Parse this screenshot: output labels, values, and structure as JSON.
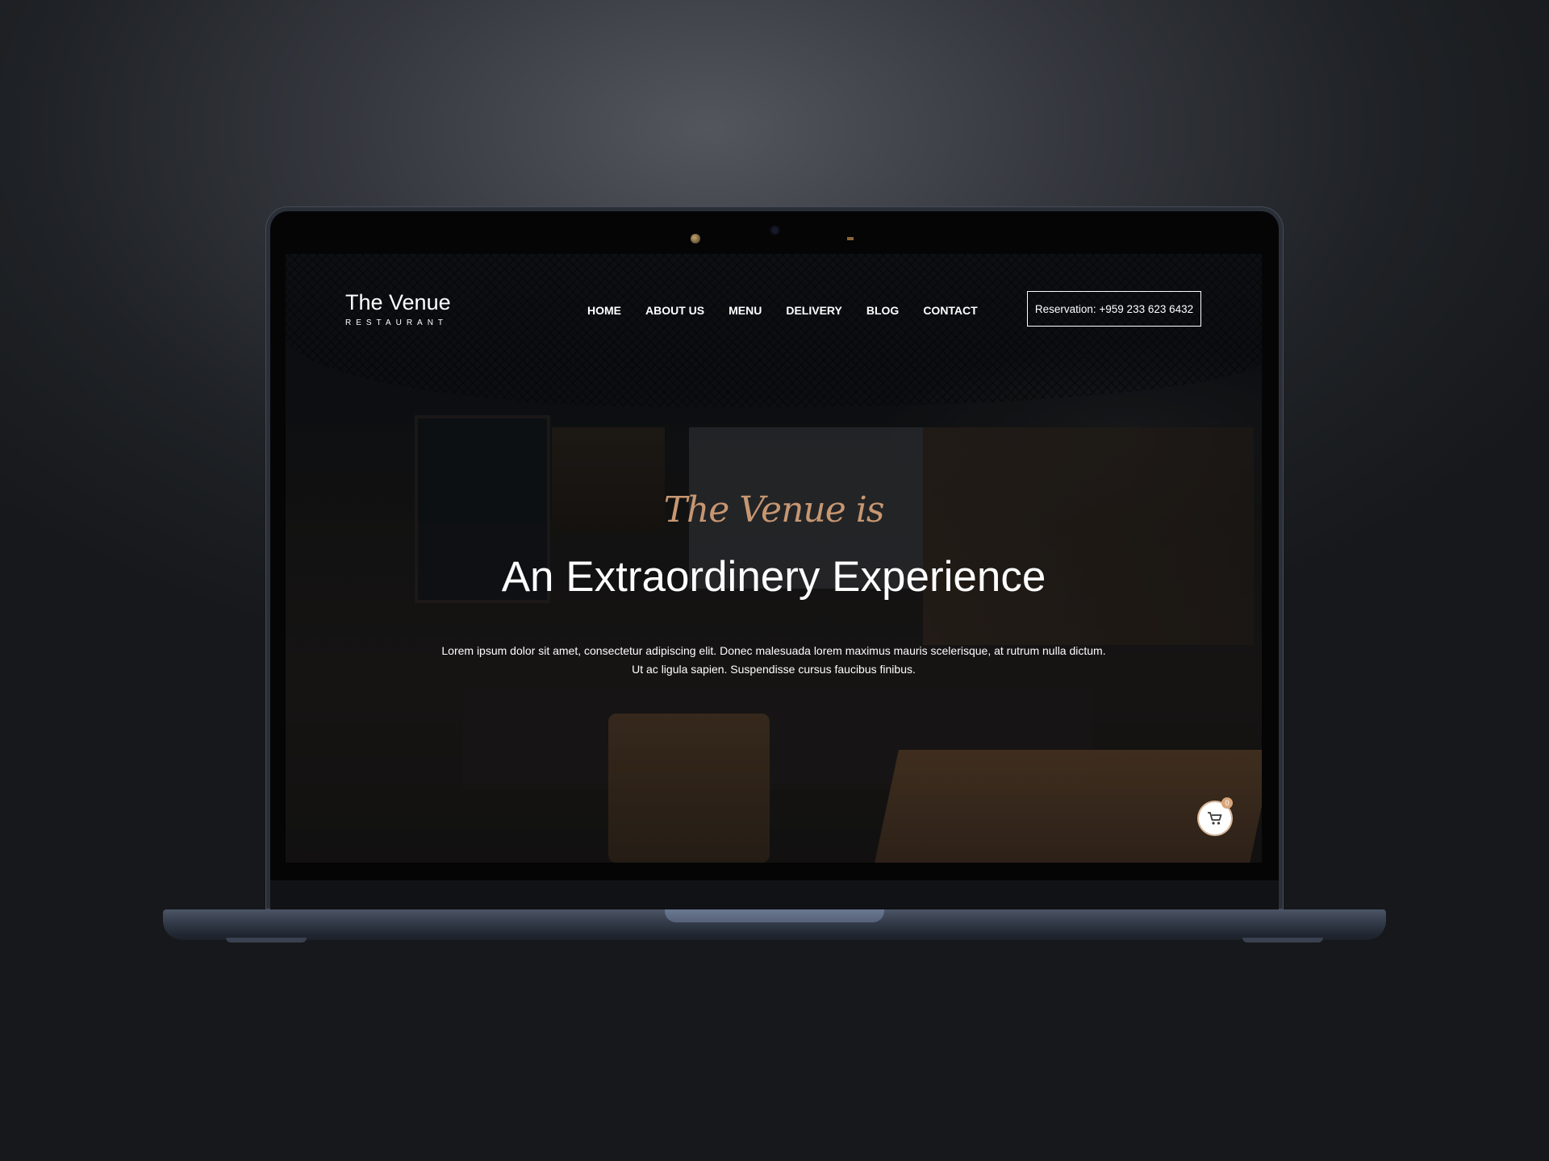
{
  "brand": {
    "title": "The Venue",
    "subtitle": "RESTAURANT"
  },
  "nav": [
    "HOME",
    "ABOUT US",
    "MENU",
    "DELIVERY",
    "BLOG",
    "CONTACT"
  ],
  "reservation": "Reservation: +959 233 623 6432",
  "hero": {
    "script": "The Venue is",
    "headline": "An Extraordinery Experience",
    "line1": "Lorem ipsum dolor sit amet, consectetur adipiscing elit. Donec malesuada lorem maximus mauris scelerisque, at rutrum nulla dictum.",
    "line2": "Ut ac ligula sapien. Suspendisse cursus faucibus finibus."
  },
  "cart": {
    "icon": "cart-icon",
    "count": "0"
  },
  "colors": {
    "accent": "#c79772",
    "text": "#ffffff"
  }
}
